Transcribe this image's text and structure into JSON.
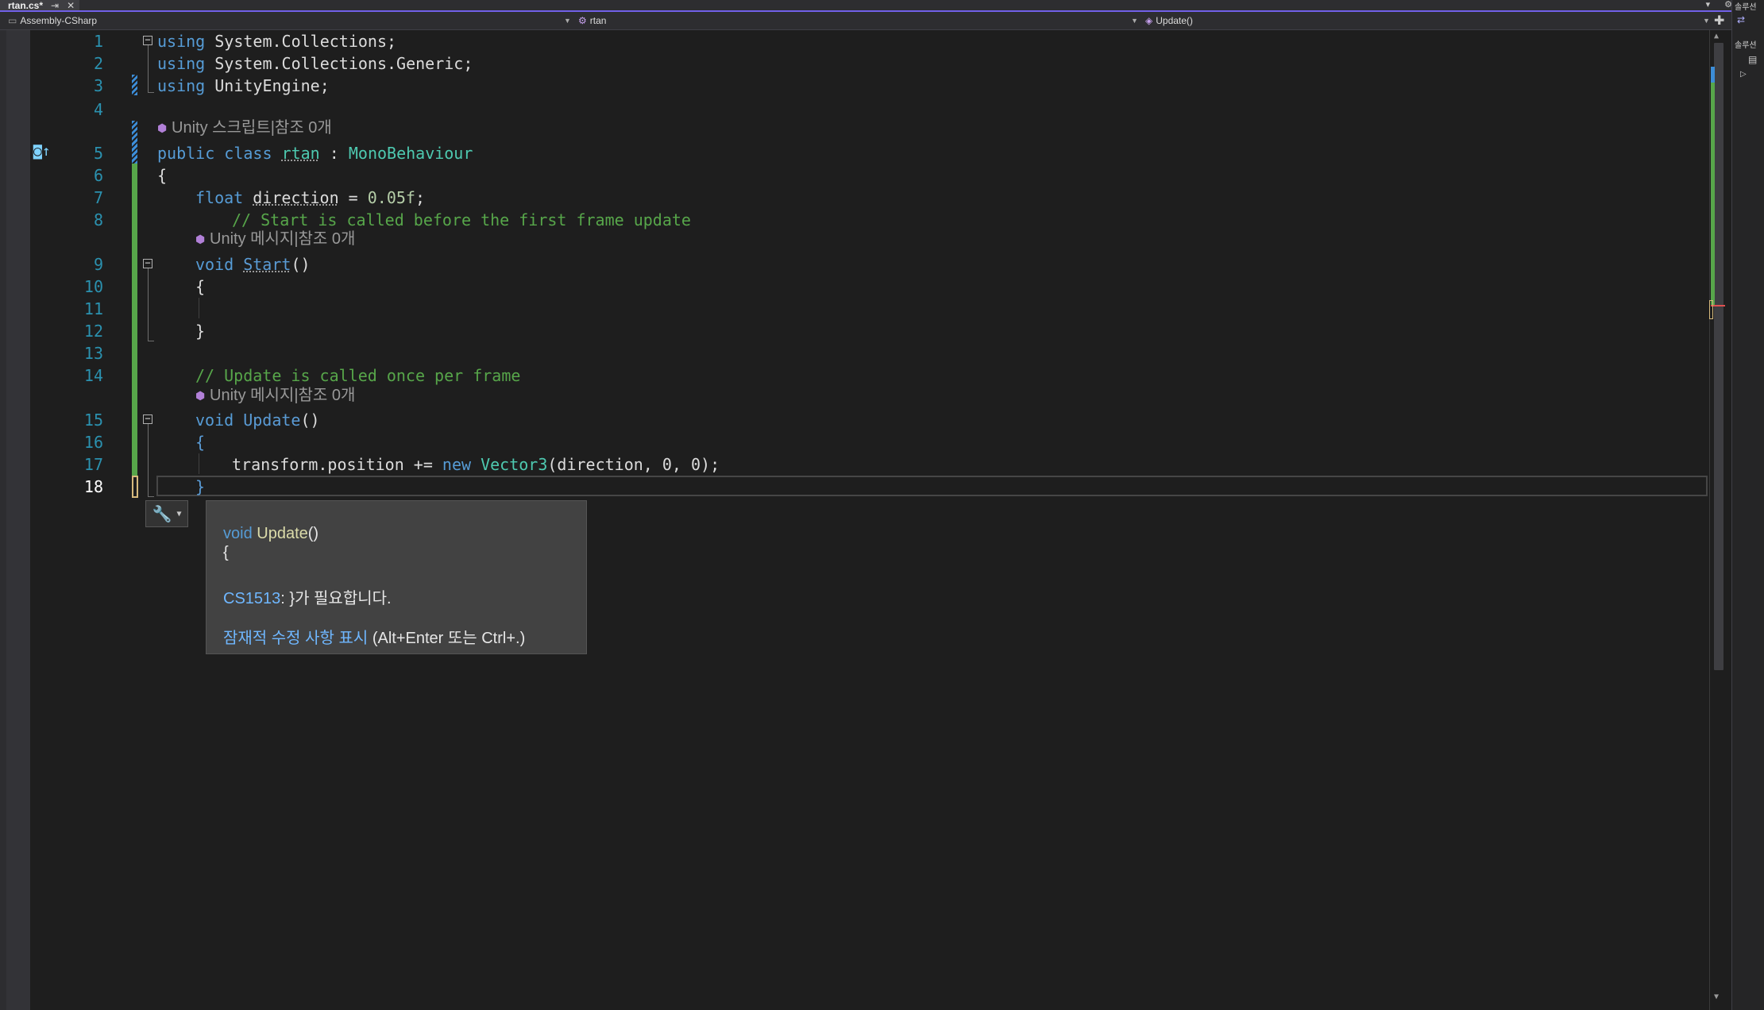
{
  "tab": {
    "title": "rtan.cs*",
    "pin": "⇥",
    "close": "✕"
  },
  "navbar": {
    "project": "Assembly-CSharp",
    "class": "rtan",
    "member": "Update()"
  },
  "side_panel": {
    "title": "솔루션"
  },
  "colors": {
    "keyword": "#569cd6",
    "type": "#4ec9b0",
    "comment": "#57a64a",
    "line_number": "#2b91af",
    "change_saved": "#57a64a",
    "change_unsaved": "#d7ba7d",
    "accent": "#7160e8"
  },
  "editor": {
    "line_numbers": [
      "1",
      "2",
      "3",
      "4",
      "5",
      "6",
      "7",
      "8",
      "9",
      "10",
      "11",
      "12",
      "13",
      "14",
      "15",
      "16",
      "17",
      "18"
    ],
    "current_line": "18",
    "code_lens": {
      "script": "Unity 스크립트|참조 0개",
      "start_msg": "Unity 메시지|참조 0개",
      "update_msg": "Unity 메시지|참조 0개"
    },
    "lines": {
      "l1": {
        "kw": "using",
        "rest": " System.Collections;"
      },
      "l2": {
        "kw": "using",
        "rest": " System.Collections.Generic;"
      },
      "l3": {
        "kw": "using",
        "rest": " UnityEngine;"
      },
      "l5": {
        "kw1": "public",
        "kw2": "class",
        "name": "rtan",
        "sep": " : ",
        "base": "MonoBehaviour"
      },
      "l6": "{",
      "l7": {
        "kw": "float",
        "var": "direction",
        "eq": " = ",
        "num": "0.05f",
        "end": ";"
      },
      "l8": "// Start is called before the first frame update",
      "l9": {
        "kw": "void",
        "fn": "Start",
        "paren": "()"
      },
      "l10": "{",
      "l12": "}",
      "l14": "// Update is called once per frame",
      "l15": {
        "kw": "void",
        "fn": "Update",
        "paren": "()"
      },
      "l16": "{",
      "l17": {
        "a": "transform.position += ",
        "kw": "new",
        "ty": "Vector3",
        "rest": "(direction, 0, 0);"
      },
      "l18": "}"
    }
  },
  "tooltip": {
    "sig_kw": "void",
    "sig_fn": "Update",
    "sig_paren": "()",
    "brace": "{",
    "error_code": "CS1513",
    "error_msg": ": }가 필요합니다.",
    "fix_link": "잠재적 수정 사항 표시",
    "fix_shortcut": " (Alt+Enter 또는 Ctrl+.)"
  }
}
